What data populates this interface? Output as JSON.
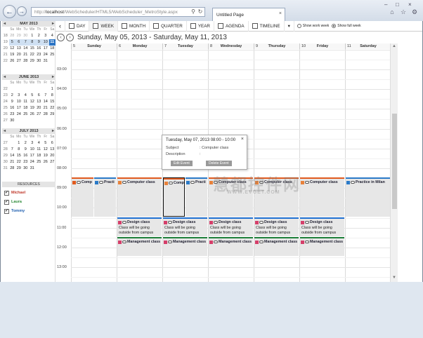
{
  "browser": {
    "url_prefix": "http://",
    "url_host": "localhost",
    "url_path": "/WebScheduler/HTML5/WebScheduler_MetroStyle.aspx",
    "tab_title": "Untitled Page"
  },
  "minicals": [
    {
      "title": "MAY 2013",
      "dow": [
        "Su",
        "Mo",
        "Tu",
        "We",
        "Th",
        "Fr",
        "Sa"
      ],
      "rows": [
        [
          "18",
          "28",
          "29",
          "30",
          "1",
          "2",
          "3",
          "4"
        ],
        [
          "19",
          "5",
          "6",
          "7",
          "8",
          "9",
          "10",
          "11"
        ],
        [
          "20",
          "12",
          "13",
          "14",
          "15",
          "16",
          "17",
          "18"
        ],
        [
          "21",
          "19",
          "20",
          "21",
          "22",
          "23",
          "24",
          "25"
        ],
        [
          "22",
          "26",
          "27",
          "28",
          "29",
          "30",
          "31",
          ""
        ]
      ]
    },
    {
      "title": "JUNE 2013",
      "dow": [
        "Su",
        "Mo",
        "Tu",
        "We",
        "Th",
        "Fr",
        "Sa"
      ],
      "rows": [
        [
          "22",
          "",
          "",
          "",
          "",
          "",
          "",
          "1"
        ],
        [
          "23",
          "2",
          "3",
          "4",
          "5",
          "6",
          "7",
          "8"
        ],
        [
          "24",
          "9",
          "10",
          "11",
          "12",
          "13",
          "14",
          "15"
        ],
        [
          "25",
          "16",
          "17",
          "18",
          "19",
          "20",
          "21",
          "22"
        ],
        [
          "26",
          "23",
          "24",
          "25",
          "26",
          "27",
          "28",
          "29"
        ],
        [
          "27",
          "30",
          "",
          "",
          "",
          "",
          "",
          ""
        ]
      ]
    },
    {
      "title": "JULY 2013",
      "dow": [
        "Su",
        "Mo",
        "Tu",
        "We",
        "Th",
        "Fr",
        "Sa"
      ],
      "rows": [
        [
          "27",
          "",
          "1",
          "2",
          "3",
          "4",
          "5",
          "6"
        ],
        [
          "28",
          "7",
          "8",
          "9",
          "10",
          "11",
          "12",
          "13"
        ],
        [
          "29",
          "14",
          "15",
          "16",
          "17",
          "18",
          "19",
          "20"
        ],
        [
          "30",
          "21",
          "22",
          "23",
          "24",
          "25",
          "26",
          "27"
        ],
        [
          "31",
          "28",
          "29",
          "30",
          "31",
          "",
          "",
          ""
        ]
      ]
    }
  ],
  "resources": {
    "title": "RESOURCES",
    "items": [
      {
        "name": "Michael",
        "color": "#c0392b"
      },
      {
        "name": "Laura",
        "color": "#2e8b3a"
      },
      {
        "name": "Tommy",
        "color": "#1f5fb0"
      }
    ]
  },
  "toolbar": {
    "views": [
      "DAY",
      "WEEK",
      "MONTH",
      "QUARTER",
      "YEAR",
      "AGENDA",
      "TIMELINE"
    ],
    "selected": "WEEK",
    "work_week": "Show work week",
    "full_week": "Show full week"
  },
  "date_range": "Sunday, May 05, 2013 - Saturday, May 11, 2013",
  "days": [
    {
      "num": "5",
      "name": "Sunday"
    },
    {
      "num": "6",
      "name": "Monday"
    },
    {
      "num": "7",
      "name": "Tuesday"
    },
    {
      "num": "8",
      "name": "Wednesday"
    },
    {
      "num": "9",
      "name": "Thursday"
    },
    {
      "num": "10",
      "name": "Friday"
    },
    {
      "num": "11",
      "name": "Saturday"
    }
  ],
  "times": [
    "03:00",
    "04:00",
    "05:00",
    "06:00",
    "07:00",
    "08:00",
    "09:00",
    "10:00",
    "11:00",
    "12:00",
    "13:00"
  ],
  "events": {
    "computer": "Computer class",
    "practice": "Practice in Milan",
    "design": "Design class",
    "management": "Management class",
    "outside": "Class will be going outside from campus",
    "comp_short": "Comp",
    "prac_short": "Practi"
  },
  "popup": {
    "title": "Tuesday, May 07, 2013 08:00 - 10:00",
    "subject_label": "Subject",
    "subject_value": ": Computer class",
    "desc_label": "Description",
    "desc_value": ":",
    "edit": "Edit Event",
    "delete": "Delete Event"
  },
  "watermark": "慧都控件网",
  "watermark_url": "WWW.EVGET.COM",
  "colors": {
    "computer": "#e05a1e",
    "practice": "#2a7ac8",
    "design": "#1f6fd0",
    "management": "#1e7f3a",
    "today": "#2b74c4"
  }
}
